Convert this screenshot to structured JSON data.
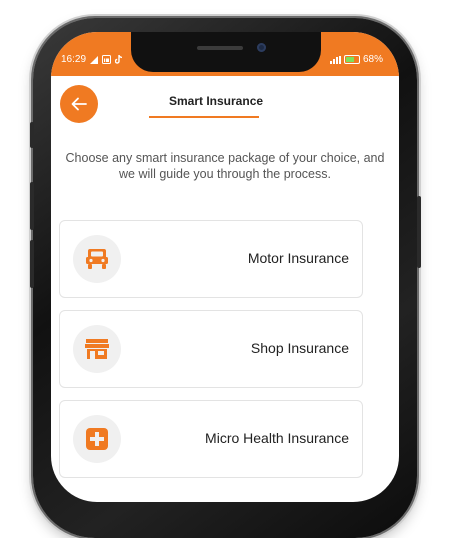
{
  "status_bar": {
    "time": "16:29",
    "battery": "68%"
  },
  "header": {
    "title": "Smart Insurance"
  },
  "intro_text": "Choose any smart insurance package of your choice, and we will guide you through the process.",
  "options": [
    {
      "label": "Motor Insurance",
      "icon": "car-icon"
    },
    {
      "label": "Shop Insurance",
      "icon": "shop-icon"
    },
    {
      "label": "Micro Health Insurance",
      "icon": "medical-cross-icon"
    }
  ],
  "colors": {
    "accent": "#f07a22",
    "icon_bg": "#f0f0f0"
  }
}
